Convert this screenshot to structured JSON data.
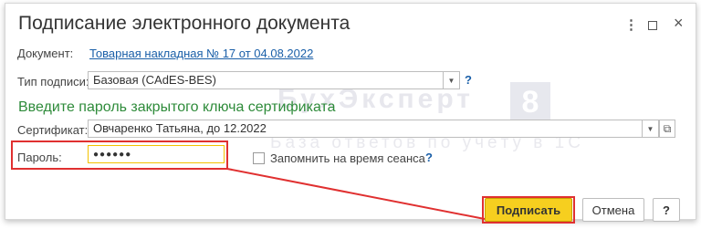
{
  "dialog": {
    "title": "Подписание электронного документа",
    "menu_icon": "⋮",
    "close_icon": "×"
  },
  "document": {
    "label": "Документ:",
    "link": "Товарная накладная № 17 от 04.08.2022"
  },
  "signature_type": {
    "label": "Тип подписи:",
    "value": "Базовая (CAdES-BES)",
    "help": "?"
  },
  "heading": "Введите пароль закрытого ключа сертификата",
  "certificate": {
    "label": "Сертификат:",
    "value": "Овчаренко Татьяна, до 12.2022",
    "open_icon": "⧉"
  },
  "password": {
    "label": "Пароль:",
    "value": "●●●●●●"
  },
  "remember": {
    "label": "Запомнить на время сеанса",
    "help": "?"
  },
  "buttons": {
    "sign": "Подписать",
    "cancel": "Отмена",
    "help": "?"
  },
  "watermark": {
    "brand": "БухЭксперт",
    "number": "8",
    "tagline": "База ответов по учёту в 1С"
  },
  "colors": {
    "accent_yellow": "#f6cf1f",
    "highlight_red": "#e03030",
    "link_blue": "#1a5fa8",
    "heading_green": "#2e8b3a"
  }
}
